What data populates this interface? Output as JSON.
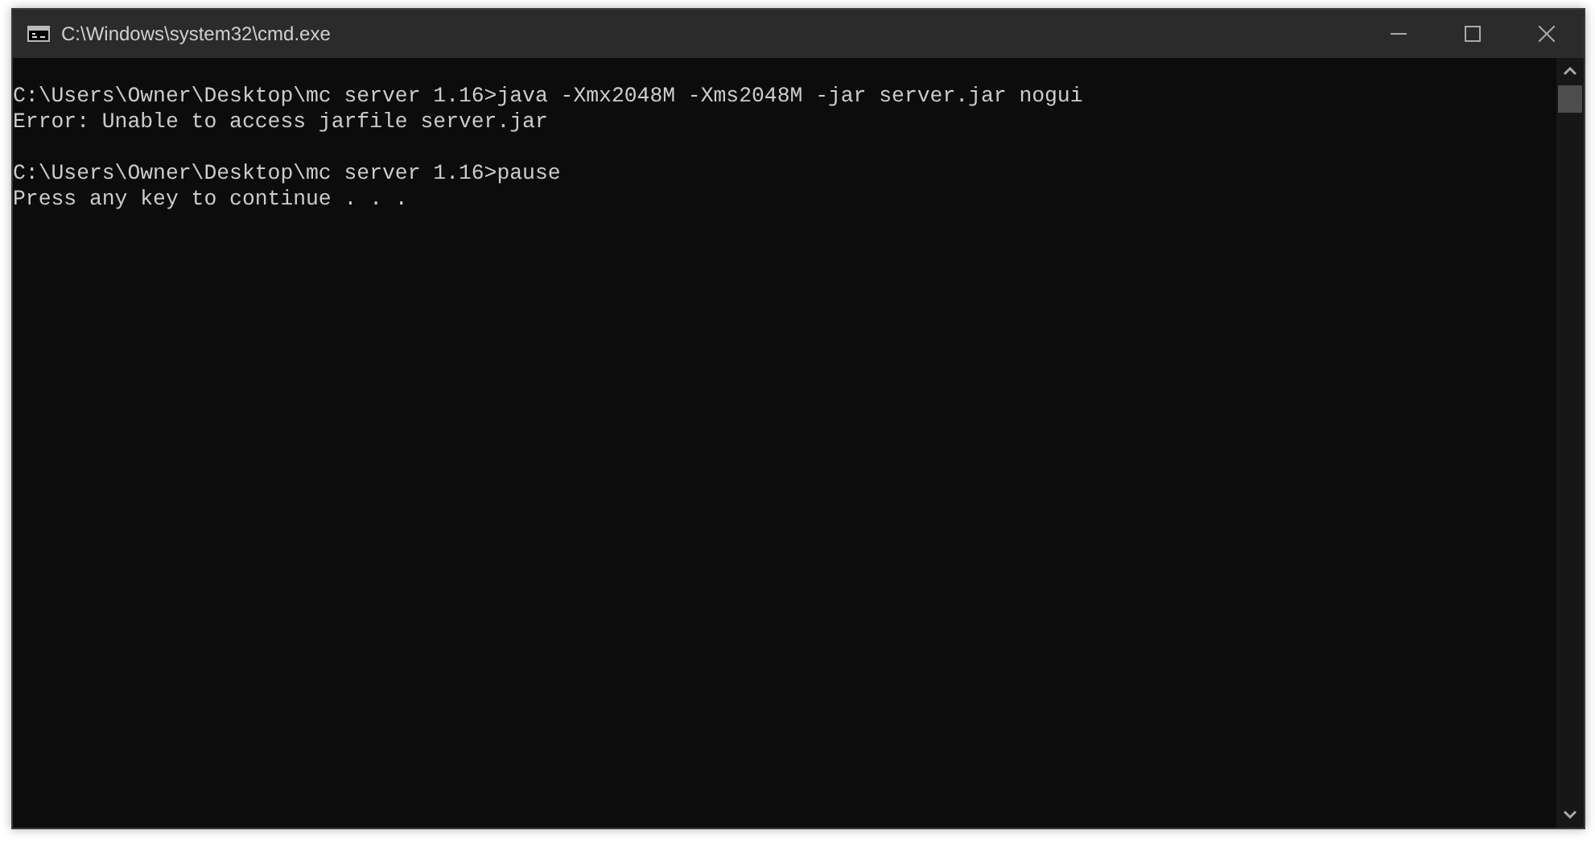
{
  "window": {
    "title": "C:\\Windows\\system32\\cmd.exe"
  },
  "console": {
    "blocks": [
      [
        "C:\\Users\\Owner\\Desktop\\mc server 1.16>java -Xmx2048M -Xms2048M -jar server.jar nogui",
        "Error: Unable to access jarfile server.jar"
      ],
      [
        "C:\\Users\\Owner\\Desktop\\mc server 1.16>pause",
        "Press any key to continue . . ."
      ]
    ]
  }
}
